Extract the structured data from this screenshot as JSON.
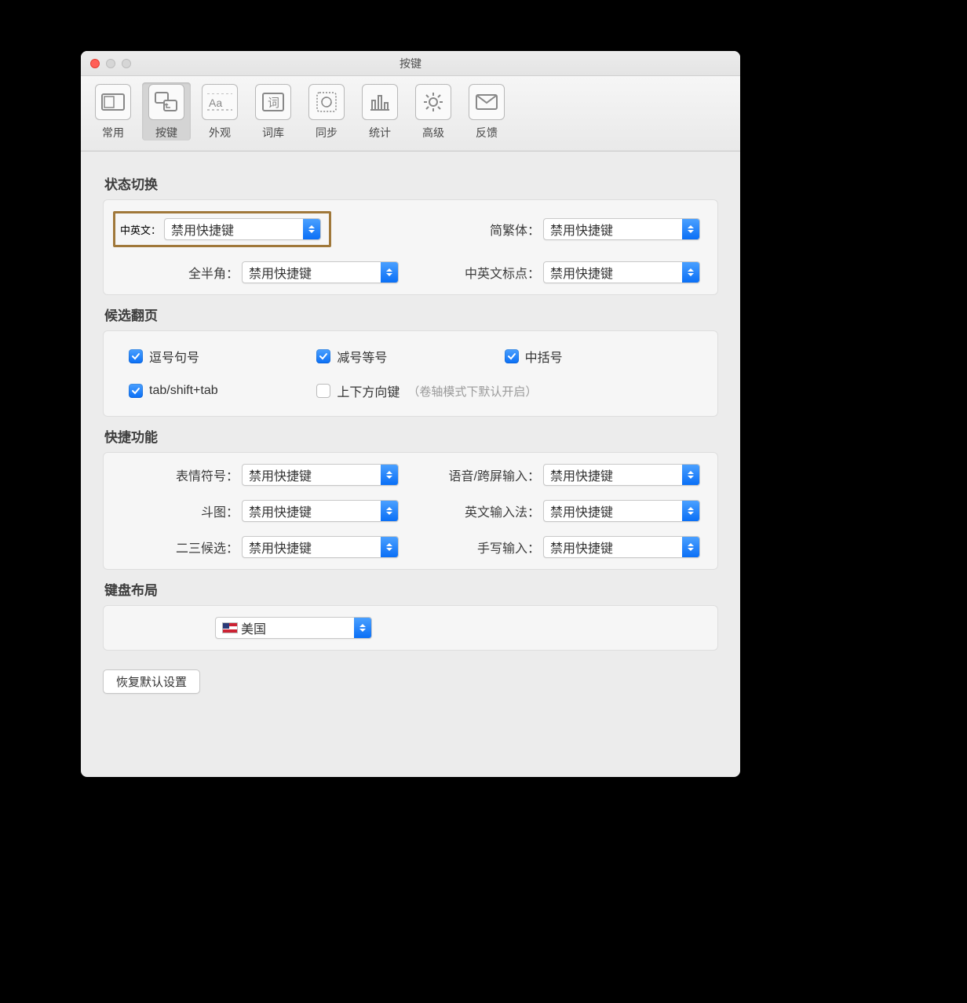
{
  "window": {
    "title": "按键"
  },
  "toolbar": {
    "items": [
      {
        "label": "常用"
      },
      {
        "label": "按键"
      },
      {
        "label": "外观"
      },
      {
        "label": "词库"
      },
      {
        "label": "同步"
      },
      {
        "label": "统计"
      },
      {
        "label": "高级"
      },
      {
        "label": "反馈"
      }
    ]
  },
  "sections": {
    "state_switch": {
      "title": "状态切换",
      "cn_en_label": "中英文：",
      "cn_en_value": "禁用快捷键",
      "trad_simp_label": "简繁体：",
      "trad_simp_value": "禁用快捷键",
      "full_half_label": "全半角：",
      "full_half_value": "禁用快捷键",
      "punct_label": "中英文标点：",
      "punct_value": "禁用快捷键"
    },
    "paging": {
      "title": "候选翻页",
      "comma_period": "逗号句号",
      "minus_equal": "减号等号",
      "brackets": "中括号",
      "tab": "tab/shift+tab",
      "arrows": "上下方向键",
      "arrows_hint": "（卷轴模式下默认开启）"
    },
    "quick": {
      "title": "快捷功能",
      "emoji_label": "表情符号：",
      "emoji_value": "禁用快捷键",
      "voice_label": "语音/跨屏输入：",
      "voice_value": "禁用快捷键",
      "doutu_label": "斗图：",
      "doutu_value": "禁用快捷键",
      "eng_label": "英文输入法：",
      "eng_value": "禁用快捷键",
      "cand23_label": "二三候选：",
      "cand23_value": "禁用快捷键",
      "hand_label": "手写输入：",
      "hand_value": "禁用快捷键"
    },
    "layout": {
      "title": "键盘布局",
      "value": "美国"
    }
  },
  "restore_label": "恢复默认设置"
}
